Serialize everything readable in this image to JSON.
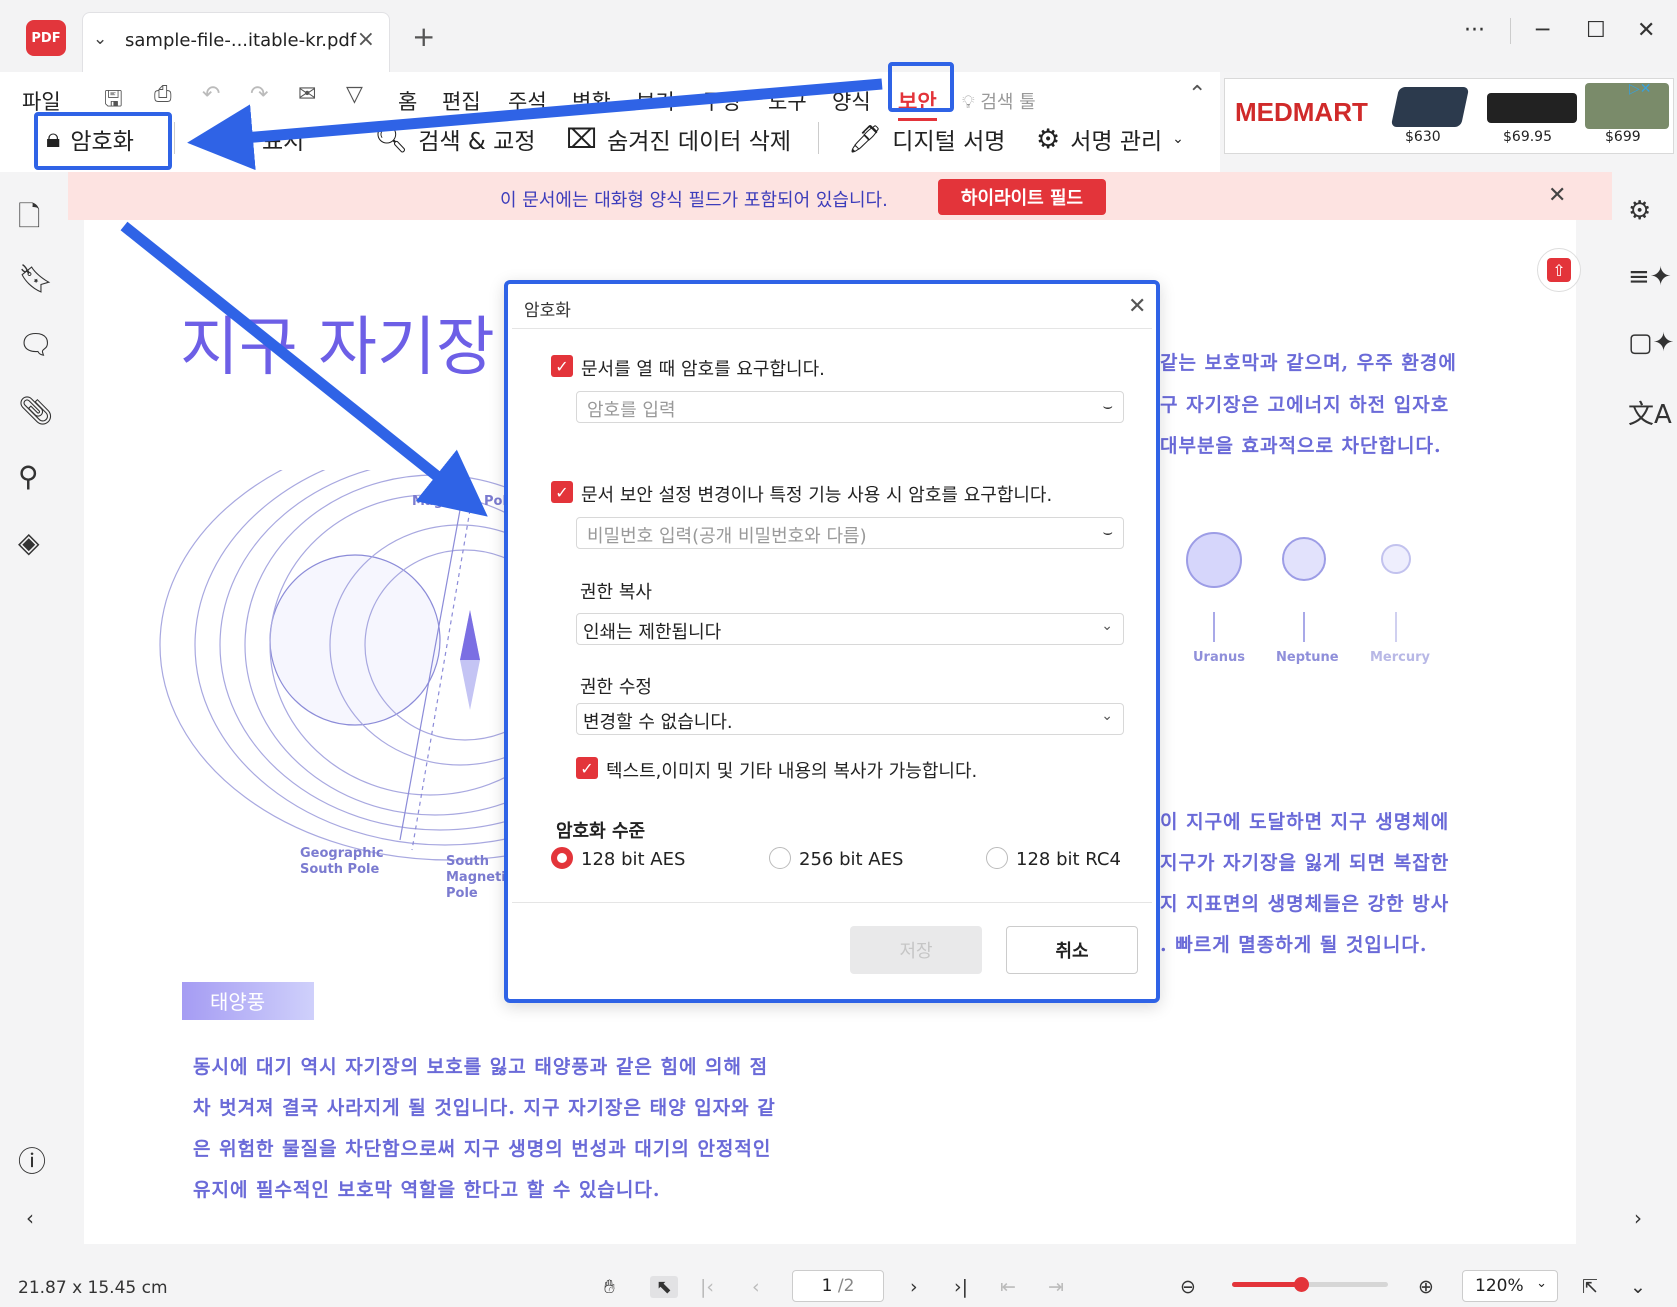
{
  "titlebar": {
    "app_icon_text": "PDF",
    "tab_title": "sample-file-...itable-kr.pdf",
    "new_tab": "+",
    "more": "···"
  },
  "menu": {
    "items": [
      "파일",
      "홈",
      "편집",
      "주석",
      "변환",
      "보기",
      "구성",
      "도구",
      "양식",
      "보안"
    ],
    "active": "보안",
    "search_tools": "검색 툴"
  },
  "toolbar": {
    "encrypt": "암호화",
    "mark_label": "표시",
    "search_redact": "검색 & 교정",
    "remove_hidden": "숨겨진 데이터 삭제",
    "digital_sign": "디지털 서명",
    "manage_sign": "서명 관리"
  },
  "ad": {
    "brand": "MEDMART",
    "prices": [
      "$630",
      "$69.95",
      "$699"
    ]
  },
  "notice": {
    "text": "이 문서에는 대화형 양식 필드가 포함되어 있습니다.",
    "button": "하이라이트 필드"
  },
  "document": {
    "heading": "지구 자기장",
    "right_para_top": [
      "같는 보호막과 같으며, 우주 환경에",
      "구 자기장은 고에너지 하전 입자호",
      "대부분을 효과적으로 차단합니다."
    ],
    "planets": [
      "Uranus",
      "Neptune",
      "Mercury"
    ],
    "magnetic_pole_label": "Magnetic Pole",
    "geographic_south_pole": [
      "Geographic",
      "South Pole"
    ],
    "south_magnetic_pole": [
      "South",
      "Magnetic",
      "Pole"
    ],
    "right_para_bottom": [
      "이 지구에 도달하면 지구 생명체에",
      "지구가 자기장을 잃게 되면 복잡한",
      "지 지표면의 생명체들은 강한 방사",
      ". 빠르게 멸종하게 될 것입니다."
    ],
    "section_badge": "태양풍",
    "bottom_para": [
      "동시에 대기 역시 자기장의 보호를 잃고 태양풍과 같은 힘에 의해 점",
      "차 벗겨져 결국 사라지게 될 것입니다. 지구 자기장은 태양 입자와 같",
      "은 위험한 물질을 차단함으로써 지구 생명의 번성과 대기의 안정적인",
      "유지에 필수적인 보호막 역할을 한다고 할 수 있습니다."
    ]
  },
  "dialog": {
    "title": "암호화",
    "open_password_check": "문서를 열 때 암호를 요구합니다.",
    "open_password_placeholder": "암호를 입력",
    "perm_password_check": "문서 보안 설정 변경이나 특정 기능 사용 시 암호를 요구합니다.",
    "perm_password_placeholder": "비밀번호 입력(공개 비밀번호와 다름)",
    "print_perm_label": "권한 복사",
    "print_perm_value": "인쇄는 제한됩니다",
    "edit_perm_label": "권한 수정",
    "edit_perm_value": "변경할 수 없습니다.",
    "copy_check": "텍스트,이미지 및 기타 내용의 복사가 가능합니다.",
    "level_label": "암호화 수준",
    "levels": [
      "128 bit AES",
      "256 bit AES",
      "128 bit RC4"
    ],
    "selected_level": "128 bit AES",
    "save": "저장",
    "cancel": "취소"
  },
  "statusbar": {
    "dimensions": "21.87 x 15.45 cm",
    "page_current": "1",
    "page_total": "/2",
    "zoom": "120%",
    "zoom_level": 0.44
  },
  "colors": {
    "accent": "#e3343a",
    "annotation": "#2f63e6",
    "doc_text": "#6a6ad8"
  }
}
